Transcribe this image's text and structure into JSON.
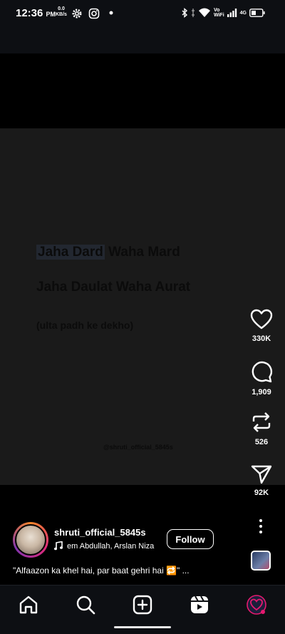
{
  "status_bar": {
    "time": "12:36",
    "ampm": "PM",
    "speed_value": "0.0",
    "speed_unit": "KB/s",
    "network_label_top": "Vo",
    "network_label_bottom": "WiFi",
    "network_gen": "4G"
  },
  "reel": {
    "overlay_line1_highlight": "Jaha Dard",
    "overlay_line1_rest": " Waha Mard",
    "overlay_line2": "Jaha Daulat Waha Aurat",
    "overlay_line3": "(ulta padh ke dekho)",
    "watermark": "@shruti_official_5845s"
  },
  "actions": {
    "likes": "330K",
    "comments": "1,909",
    "reposts": "526",
    "shares": "92K"
  },
  "author": {
    "username": "shruti_official_5845s",
    "music": "em Abdullah, Arslan Niza",
    "follow_label": "Follow"
  },
  "caption": "\"Alfaazon ka khel hai, par baat gehri hai 🔁\" ..."
}
